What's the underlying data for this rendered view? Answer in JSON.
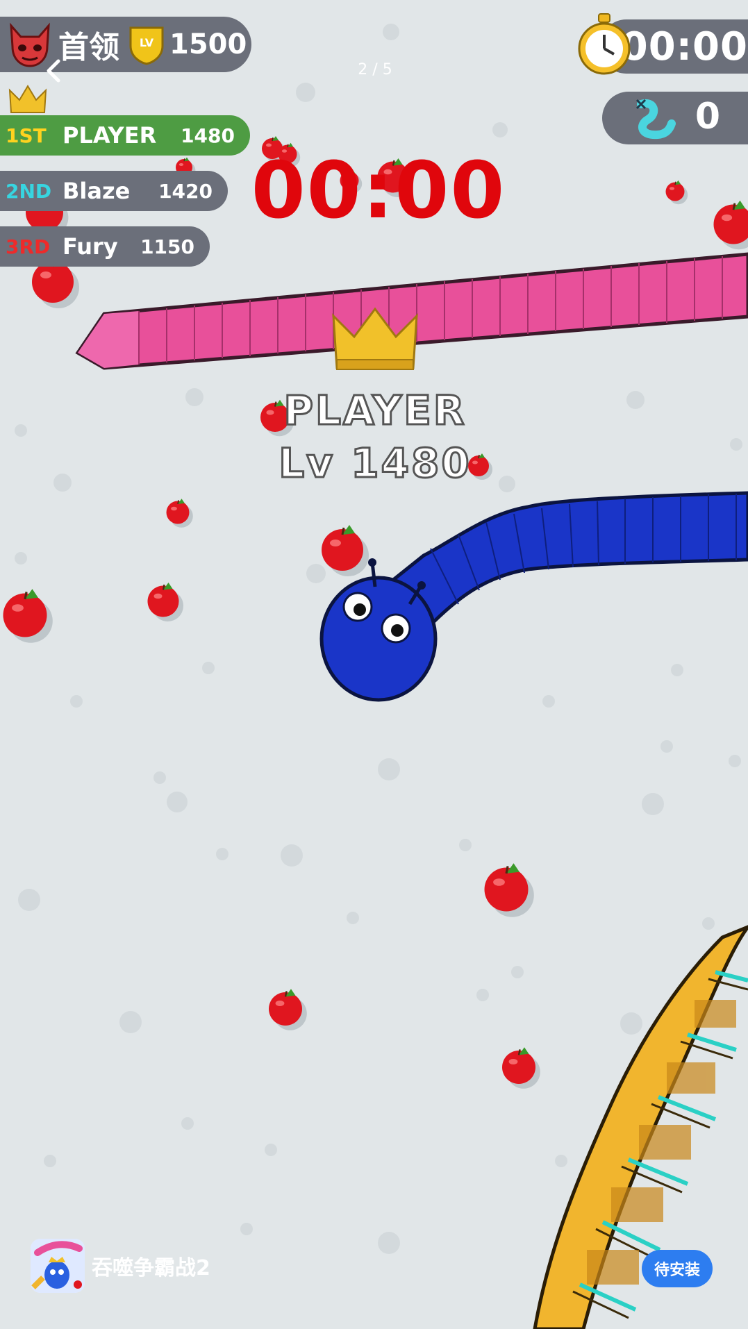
{
  "hud": {
    "leader_label": "首领",
    "lv_badge": "LV",
    "leader_level": "1500",
    "timer_small": "00:00",
    "kill_count": "0",
    "page_indicator": "2 / 5"
  },
  "leaderboard": [
    {
      "rank": "1ST",
      "name": "PLAYER",
      "score": "1480",
      "bg": "#4e9c43",
      "rank_color": "#ffd21f"
    },
    {
      "rank": "2ND",
      "name": "Blaze",
      "score": "1420",
      "bg": "#6b6f7a",
      "rank_color": "#37d5e0"
    },
    {
      "rank": "3RD",
      "name": "Fury",
      "score": "1150",
      "bg": "#6b6f7a",
      "rank_color": "#ee2a2a"
    }
  ],
  "center": {
    "big_timer": "00:00",
    "player_name": "PLAYER",
    "player_level": "Lv 1480"
  },
  "ad": {
    "app_name": "吞噬争霸战2",
    "install_label": "待安装"
  },
  "colors": {
    "pink_snake": "#e8509a",
    "blue_snake": "#1a35c8",
    "gold_snake": "#f1b52e",
    "apple": "#e0161f",
    "timer_red": "#e0060c"
  },
  "icons": [
    "devil-face-icon",
    "lv-shield-icon",
    "crown-icon",
    "stopwatch-icon",
    "snake-kill-icon",
    "back-arrow-icon",
    "apple-icon"
  ]
}
